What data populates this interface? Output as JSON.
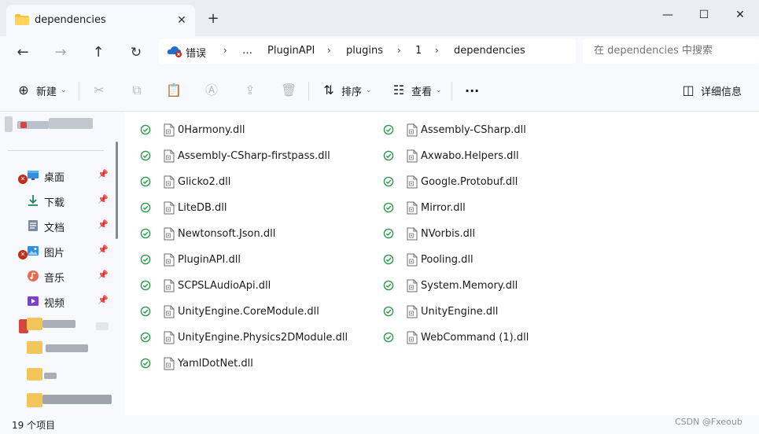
{
  "tab": {
    "title": "dependencies",
    "close": "✕",
    "new": "+"
  },
  "window": {
    "minimize": "—",
    "maximize": "☐",
    "close": "✕"
  },
  "nav": {
    "back": "←",
    "forward": "→",
    "up": "↑",
    "refresh": "↻"
  },
  "address": {
    "error_label": "错误",
    "breadcrumbs": [
      "…",
      "PluginAPI",
      "plugins",
      "1",
      "dependencies"
    ]
  },
  "search": {
    "placeholder": "在 dependencies 中搜索"
  },
  "toolbar": {
    "new_label": "新建",
    "sort_label": "排序",
    "view_label": "查看",
    "more_label": "···",
    "details_label": "详细信息"
  },
  "sidebar": {
    "items": [
      {
        "label": "桌面",
        "pin": "📌",
        "icon": "desktop-icon"
      },
      {
        "label": "下载",
        "pin": "📌",
        "icon": "download-icon"
      },
      {
        "label": "文档",
        "pin": "📌",
        "icon": "document-icon"
      },
      {
        "label": "图片",
        "pin": "📌",
        "icon": "pictures-icon"
      },
      {
        "label": "音乐",
        "pin": "📌",
        "icon": "music-icon"
      },
      {
        "label": "视频",
        "pin": "📌",
        "icon": "video-icon"
      }
    ]
  },
  "files": {
    "left": [
      "0Harmony.dll",
      "Assembly-CSharp-firstpass.dll",
      "Glicko2.dll",
      "LiteDB.dll",
      "Newtonsoft.Json.dll",
      "PluginAPI.dll",
      "SCPSLAudioApi.dll",
      "UnityEngine.CoreModule.dll",
      "UnityEngine.Physics2DModule.dll",
      "YamlDotNet.dll"
    ],
    "right": [
      "Assembly-CSharp.dll",
      "Axwabo.Helpers.dll",
      "Google.Protobuf.dll",
      "Mirror.dll",
      "NVorbis.dll",
      "Pooling.dll",
      "System.Memory.dll",
      "UnityEngine.dll",
      "WebCommand (1).dll"
    ]
  },
  "status": {
    "count": "19 个项目"
  },
  "watermark": "CSDN @Fxeoub",
  "colors": {
    "sync_ok": "#2c9a4a",
    "error": "#c42b1c",
    "folder": "#f5c242"
  }
}
